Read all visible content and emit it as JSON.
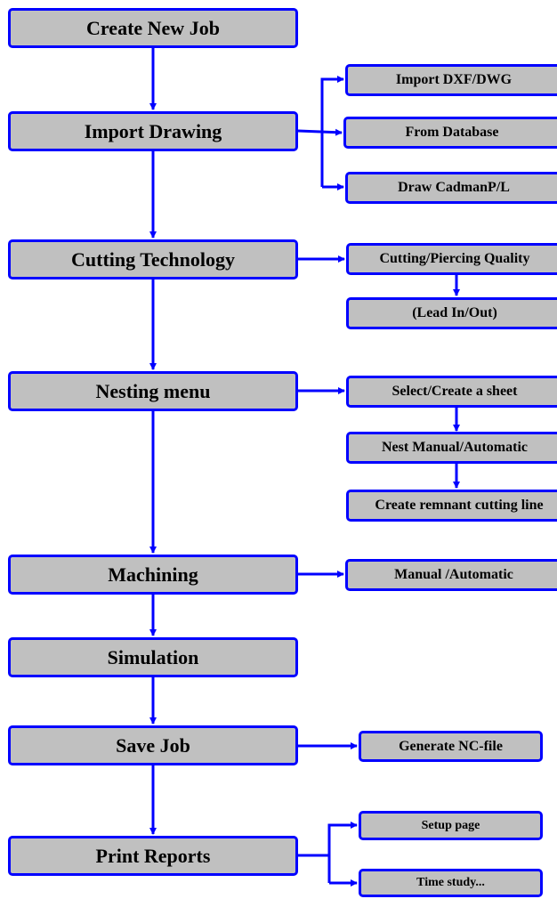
{
  "diagram": {
    "line_color": "#0000ff",
    "box_fill": "#c0c0c0",
    "main_steps": [
      "Create New Job",
      "Import Drawing",
      "Cutting Technology",
      "Nesting menu",
      "Machining",
      "Simulation",
      "Save Job",
      "Print Reports"
    ],
    "import_options": [
      "Import DXF/DWG",
      "From Database",
      "Draw CadmanP/L"
    ],
    "cutting_steps": [
      "Cutting/Piercing Quality",
      "(Lead In/Out)"
    ],
    "nesting_steps": [
      "Select/Create a sheet",
      "Nest Manual/Automatic",
      "Create remnant cutting line"
    ],
    "machining_options": [
      "Manual /Automatic"
    ],
    "save_options": [
      "Generate NC-file"
    ],
    "print_options": [
      "Setup page",
      "Time study..."
    ]
  }
}
